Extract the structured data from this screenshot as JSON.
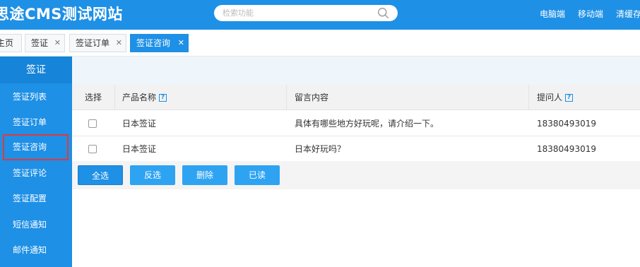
{
  "header": {
    "title": "思途CMS测试网站",
    "search_placeholder": "检索功能",
    "links": [
      "电脑端",
      "移动端",
      "清缓存"
    ]
  },
  "tabs": [
    {
      "label": "主页",
      "closable": false
    },
    {
      "label": "签证",
      "closable": true
    },
    {
      "label": "签证订单",
      "closable": true
    },
    {
      "label": "签证咨询",
      "closable": true,
      "active": true
    }
  ],
  "sidebar": {
    "heading": "签证",
    "items": [
      {
        "label": "签证列表"
      },
      {
        "label": "签证订单"
      },
      {
        "label": "签证咨询",
        "selected": true
      },
      {
        "label": "签证评论"
      },
      {
        "label": "签证配置"
      },
      {
        "label": "短信通知"
      },
      {
        "label": "邮件通知"
      }
    ]
  },
  "table": {
    "columns": {
      "select": "选择",
      "product": "产品名称",
      "message": "留言内容",
      "asker": "提问人"
    },
    "rows": [
      {
        "product": "日本签证",
        "message": "具体有哪些地方好玩呢，请介绍一下。",
        "asker": "18380493019"
      },
      {
        "product": "日本签证",
        "message": "日本好玩吗？",
        "asker": "18380493019"
      }
    ]
  },
  "actions": {
    "select_all": "全选",
    "invert": "反选",
    "delete": "删除",
    "mark_read": "已读"
  },
  "colors": {
    "accent": "#1e90e6",
    "selection_outline": "#e03a3a"
  },
  "icons": {
    "search": "search-icon",
    "close": "close-icon",
    "help": "help-icon"
  }
}
